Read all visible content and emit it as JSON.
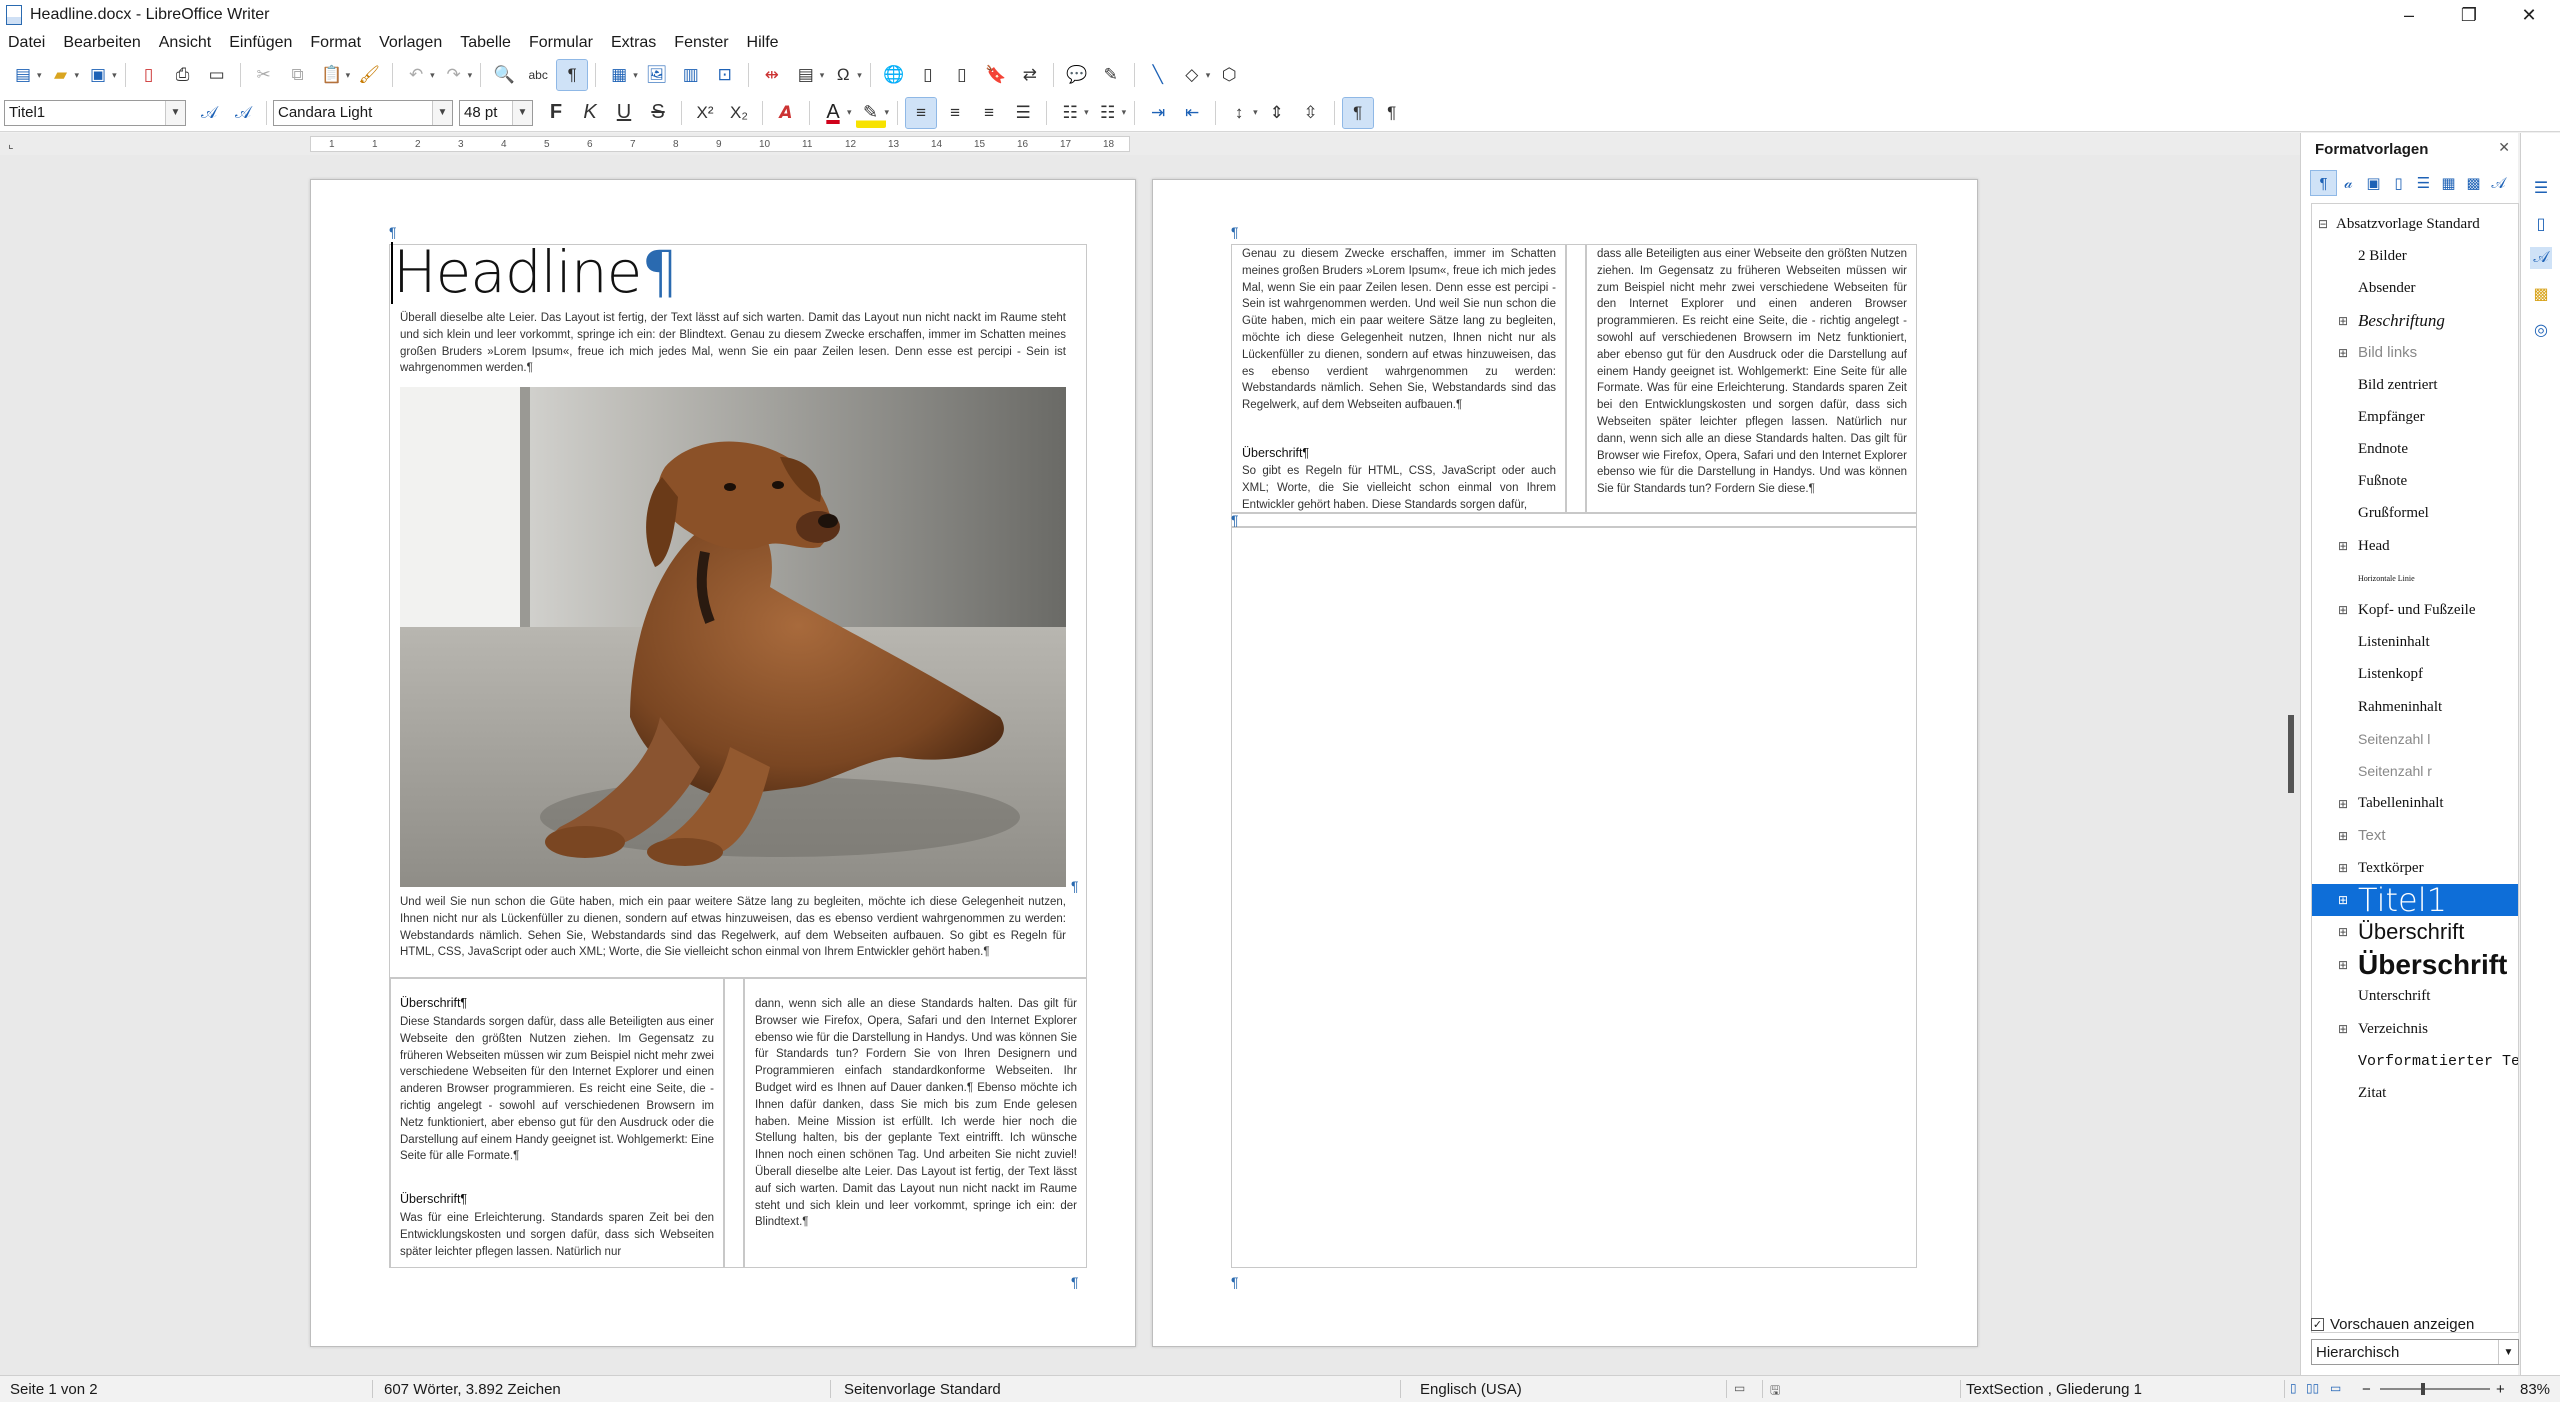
{
  "window": {
    "title": "Headline.docx - LibreOffice Writer",
    "controls": {
      "minimize": "–",
      "restore": "❐",
      "close": "✕"
    }
  },
  "menu": [
    "Datei",
    "Bearbeiten",
    "Ansicht",
    "Einfügen",
    "Format",
    "Vorlagen",
    "Tabelle",
    "Formular",
    "Extras",
    "Fenster",
    "Hilfe"
  ],
  "formatting": {
    "paragraph_style": "Titel1",
    "font_name": "Candara Light",
    "font_size": "48 pt",
    "bold_label": "F",
    "italic_label": "K",
    "underline_label": "U",
    "strike_label": "S",
    "superscript_label": "X²",
    "subscript_label": "X₂",
    "font_color": "#d0021b",
    "highlight_color": "#f7e200"
  },
  "ruler": {
    "ticks": [
      "1",
      "1",
      "2",
      "3",
      "4",
      "5",
      "6",
      "7",
      "8",
      "9",
      "10",
      "11",
      "12",
      "13",
      "14",
      "15",
      "16",
      "17",
      "18"
    ]
  },
  "document": {
    "page1": {
      "headline": "Headline",
      "pilcrow": "¶",
      "intro": "Überall dieselbe alte Leier. Das Layout ist fertig, der Text lässt auf sich warten. Damit das Layout nun nicht nackt im Raume steht und sich klein und leer vorkommt, springe ich ein: der Blindtext. Genau zu diesem Zwecke erschaffen, immer im Schatten meines großen Bruders »Lorem Ipsum«, freue ich mich jedes Mal, wenn Sie ein paar Zeilen lesen. Denn esse est percipi - Sein ist wahrgenommen werden.¶",
      "after_image": "Und weil Sie nun schon die Güte haben, mich ein paar weitere Sätze lang zu begleiten, möchte ich diese Gelegenheit nutzen, Ihnen nicht nur als Lückenfüller zu dienen, sondern auf etwas hinzuweisen, das es ebenso verdient wahrgenommen zu werden: Webstandards nämlich. Sehen Sie, Webstandards sind das Regelwerk, auf dem Webseiten aufbauen. So gibt es Regeln für HTML, CSS, JavaScript oder auch XML; Worte, die Sie vielleicht schon einmal von Ihrem Entwickler gehört haben.¶",
      "col1_heading1": "Überschrift¶",
      "col1_text1": "Diese Standards sorgen dafür, dass alle Beteiligten aus einer Webseite den größten Nutzen ziehen. Im Gegensatz zu früheren Webseiten müssen wir zum Beispiel nicht mehr zwei verschiedene Webseiten für den Internet Explorer und einen anderen Browser programmieren. Es reicht eine Seite, die - richtig angelegt - sowohl auf verschiedenen Browsern im Netz funktioniert, aber ebenso gut für den Ausdruck oder die Darstellung auf einem Handy geeignet ist. Wohlgemerkt: Eine Seite für alle Formate.¶",
      "col1_heading2": "Überschrift¶",
      "col1_text2": "Was für eine Erleichterung. Standards sparen Zeit bei den Entwicklungskosten und sorgen dafür, dass sich Webseiten später leichter pflegen lassen. Natürlich nur",
      "col2_text": "dann, wenn sich alle an diese Standards halten. Das gilt für Browser wie Firefox, Opera, Safari und den Internet Explorer ebenso wie für die Darstellung in Handys. Und was können Sie für Standards tun? Fordern Sie von Ihren Designern und Programmieren einfach standardkonforme Webseiten. Ihr Budget wird es Ihnen auf Dauer danken.¶ Ebenso möchte ich Ihnen dafür danken, dass Sie mich bis zum Ende gelesen haben. Meine Mission ist erfüllt. Ich werde hier noch die Stellung halten, bis der geplante Text eintrifft. Ich wünsche Ihnen noch einen schönen Tag. Und arbeiten Sie nicht zuviel! Überall dieselbe alte Leier. Das Layout ist fertig, der Text lässt auf sich warten. Damit das Layout nun nicht nackt im Raume steht und sich klein und leer vorkommt, springe ich ein: der Blindtext.¶"
    },
    "page2": {
      "col1_text": "Genau zu diesem Zwecke erschaffen, immer im Schatten meines großen Bruders »Lorem Ipsum«, freue ich mich jedes Mal, wenn Sie ein paar Zeilen lesen. Denn esse est percipi - Sein ist wahrgenommen werden. Und weil Sie nun schon die Güte haben, mich ein paar weitere Sätze lang zu begleiten, möchte ich diese Gelegenheit nutzen, Ihnen nicht nur als Lückenfüller zu dienen, sondern auf etwas hinzuweisen, das es ebenso verdient wahrgenommen zu werden: Webstandards nämlich. Sehen Sie, Webstandards sind das Regelwerk, auf dem Webseiten aufbauen.¶",
      "col1_heading": "Überschrift¶",
      "col1_text2": "So gibt es Regeln für HTML, CSS, JavaScript oder auch XML; Worte, die Sie vielleicht schon einmal von Ihrem Entwickler gehört haben. Diese Standards sorgen dafür,",
      "col2_text": "dass alle Beteiligten aus einer Webseite den größten Nutzen ziehen. Im Gegensatz zu früheren Webseiten müssen wir zum Beispiel nicht mehr zwei verschiedene Webseiten für den Internet Explorer und einen anderen Browser programmieren. Es reicht eine Seite, die - richtig angelegt - sowohl auf verschiedenen Browsern im Netz funktioniert, aber ebenso gut für den Ausdruck oder die Darstellung auf einem Handy geeignet ist. Wohlgemerkt: Eine Seite für alle Formate. Was für eine Erleichterung. Standards sparen Zeit bei den Entwicklungskosten und sorgen dafür, dass sich Webseiten später leichter pflegen lassen. Natürlich nur dann, wenn sich alle an diese Standards halten. Das gilt für Browser wie Firefox, Opera, Safari und den Internet Explorer ebenso wie für die Darstellung in Handys. Und was können Sie für Standards tun? Fordern Sie diese.¶"
    }
  },
  "sidebar": {
    "title": "Formatvorlagen",
    "close": "✕",
    "styles": [
      {
        "name": "Absatzvorlage Standard",
        "expander": "⊟",
        "font": "serif",
        "size": 15
      },
      {
        "name": "2 Bilder",
        "expander": "",
        "font": "serif",
        "size": 15
      },
      {
        "name": "Absender",
        "expander": "",
        "font": "serif",
        "size": 15
      },
      {
        "name": "Beschriftung",
        "expander": "⊞",
        "font": "serif-italic",
        "size": 17
      },
      {
        "name": "Bild links",
        "expander": "⊞",
        "font": "sans-gray",
        "size": 15
      },
      {
        "name": "Bild zentriert",
        "expander": "",
        "font": "serif",
        "size": 15
      },
      {
        "name": "Empfänger",
        "expander": "",
        "font": "serif",
        "size": 15
      },
      {
        "name": "Endnote",
        "expander": "",
        "font": "serif",
        "size": 15
      },
      {
        "name": "Fußnote",
        "expander": "",
        "font": "serif",
        "size": 15
      },
      {
        "name": "Grußformel",
        "expander": "",
        "font": "serif",
        "size": 15
      },
      {
        "name": "Head",
        "expander": "⊞",
        "font": "serif",
        "size": 15
      },
      {
        "name": "Horizontale Linie",
        "expander": "",
        "font": "serif",
        "size": 8
      },
      {
        "name": "Kopf- und Fußzeile",
        "expander": "⊞",
        "font": "serif",
        "size": 15
      },
      {
        "name": "Listeninhalt",
        "expander": "",
        "font": "serif",
        "size": 15
      },
      {
        "name": "Listenkopf",
        "expander": "",
        "font": "serif",
        "size": 15
      },
      {
        "name": "Rahmeninhalt",
        "expander": "",
        "font": "serif",
        "size": 15
      },
      {
        "name": "Seitenzahl l",
        "expander": "",
        "font": "sans-gray",
        "size": 14
      },
      {
        "name": "Seitenzahl r",
        "expander": "",
        "font": "sans-gray",
        "size": 14
      },
      {
        "name": "Tabelleninhalt",
        "expander": "⊞",
        "font": "serif",
        "size": 15
      },
      {
        "name": "Text",
        "expander": "⊞",
        "font": "sans-gray",
        "size": 15
      },
      {
        "name": "Textkörper",
        "expander": "⊞",
        "font": "serif",
        "size": 15
      },
      {
        "name": "Titel1",
        "expander": "⊞",
        "font": "light",
        "size": 32,
        "selected": true
      },
      {
        "name": "Überschrift",
        "expander": "⊞",
        "font": "sans",
        "size": 22
      },
      {
        "name": "Überschrift",
        "expander": "⊞",
        "font": "sans-bold",
        "size": 28
      },
      {
        "name": "Unterschrift",
        "expander": "",
        "font": "serif",
        "size": 15
      },
      {
        "name": "Verzeichnis",
        "expander": "⊞",
        "font": "serif",
        "size": 15
      },
      {
        "name": "Vorformatierter Text",
        "expander": "",
        "font": "mono",
        "size": 15
      },
      {
        "name": "Zitat",
        "expander": "",
        "font": "serif",
        "size": 15
      }
    ],
    "preview_checkbox": "Vorschauen anzeigen",
    "preview_checked": "✓",
    "filter": "Hierarchisch"
  },
  "statusbar": {
    "page": "Seite 1 von 2",
    "words": "607 Wörter, 3.892 Zeichen",
    "page_style": "Seitenvorlage Standard",
    "language": "Englisch (USA)",
    "section": "TextSection , Gliederung 1",
    "zoom": "83%",
    "zoom_level": 0.83
  },
  "colors": {
    "accent": "#0e6ed8",
    "pilcrow": "#2a6ab0"
  }
}
